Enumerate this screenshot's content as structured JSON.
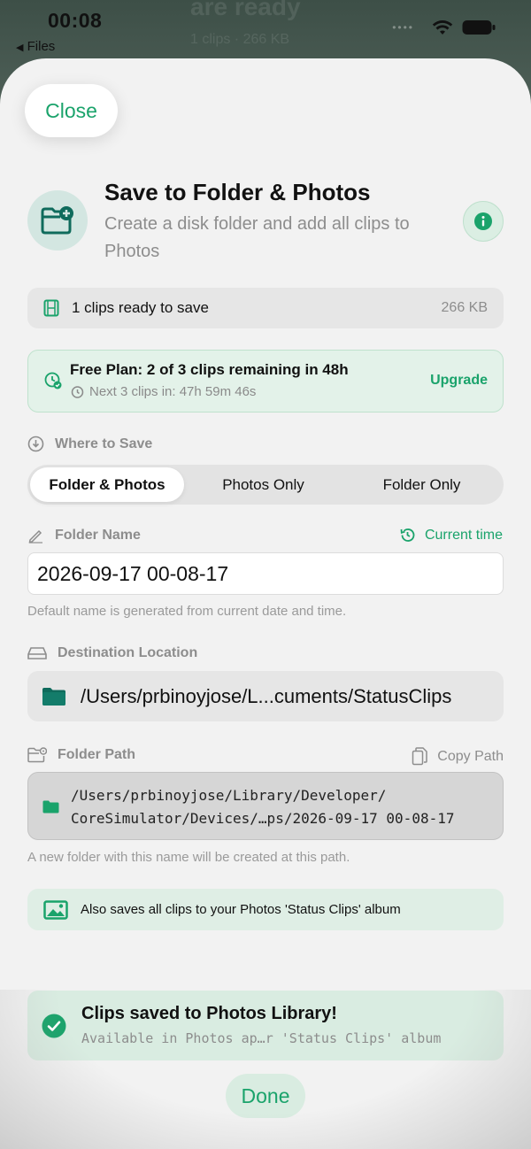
{
  "status_bar": {
    "time": "00:08",
    "back_label": "Files"
  },
  "background_app": {
    "line1": "are ready",
    "line2": "1 clips · 266 KB"
  },
  "sheet": {
    "close_label": "Close",
    "title": "Save to Folder & Photos",
    "subtitle": "Create a disk folder and add all clips to Photos",
    "header_icon": "folder-badge-plus-icon",
    "info_icon": "info-icon"
  },
  "clips_summary": {
    "label": "1 clips ready to save",
    "size": "266 KB",
    "icon": "film-strip-icon"
  },
  "plan": {
    "title": "Free Plan: 2 of 3 clips remaining in 48h",
    "next": "Next 3 clips in: 47h 59m 46s",
    "upgrade_label": "Upgrade"
  },
  "where_to_save": {
    "label": "Where to Save",
    "options": [
      "Folder & Photos",
      "Photos Only",
      "Folder Only"
    ],
    "selected": "Folder & Photos"
  },
  "folder_name": {
    "label": "Folder Name",
    "current_time_label": "Current time",
    "value": "2026-09-17 00-08-17",
    "hint": "Default name is generated from current date and time."
  },
  "destination": {
    "label": "Destination Location",
    "path": "/Users/prbinoyjose/L...cuments/StatusClips"
  },
  "folder_path": {
    "label": "Folder Path",
    "copy_label": "Copy Path",
    "line1": "/Users/prbinoyjose/Library/Developer/",
    "line2": "CoreSimulator/Devices/…ps/2026-09-17 00-08-17",
    "hint": "A new folder with this name will be created at this path."
  },
  "photos_note": {
    "label": "Also saves all clips to your Photos 'Status Clips' album"
  },
  "saved_banner": {
    "title": "Clips saved to Photos Library!",
    "subtitle": "Available in Photos ap…r 'Status Clips' album"
  },
  "done_label": "Done",
  "colors": {
    "accent": "#1aa36b",
    "sheet_bg": "#f2f2f2",
    "success_bg": "#d9ece1",
    "folder_icon": "#0f6b5c"
  }
}
